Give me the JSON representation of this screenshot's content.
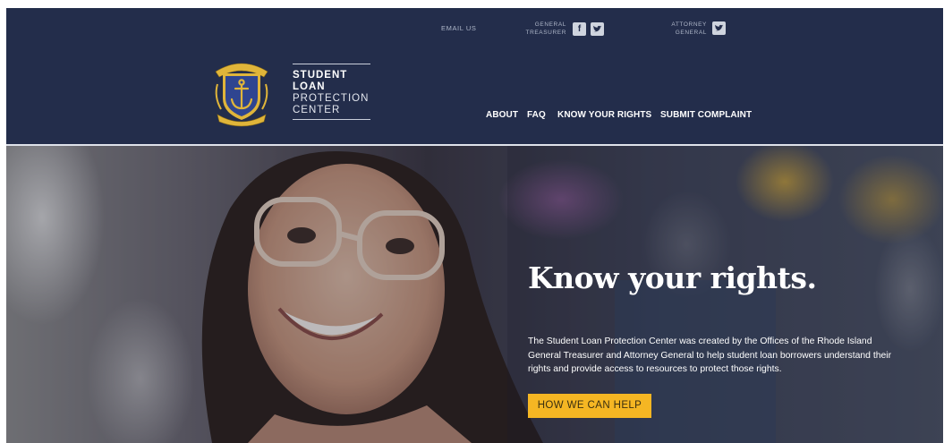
{
  "header": {
    "utility": {
      "email_label": "EMAIL US",
      "treasurer_label_line1": "GENERAL",
      "treasurer_label_line2": "TREASURER",
      "attorney_label_line1": "ATTORNEY",
      "attorney_label_line2": "GENERAL",
      "facebook_glyph": "f",
      "twitter_glyph": "t"
    },
    "brand": {
      "line1": "STUDENT",
      "line2": "LOAN",
      "line3": "PROTECTION",
      "line4": "CENTER"
    },
    "nav": [
      "ABOUT",
      "FAQ",
      "KNOW YOUR RIGHTS",
      "SUBMIT COMPLAINT"
    ]
  },
  "hero": {
    "title": "Know your rights.",
    "body": "The Student Loan Protection Center was created by the Offices of the Rhode Island General Treasurer and Attorney General to help student loan borrowers understand their rights and provide access to resources to protect those rights.",
    "cta_label": "HOW WE CAN HELP"
  },
  "colors": {
    "header_bg": "#232d4b",
    "cta_bg": "#f5b623",
    "seal_gold": "#e0b53a",
    "seal_blue": "#2f4590"
  },
  "icons": {
    "seal": "rhode-island-state-seal",
    "facebook": "facebook-icon",
    "twitter": "twitter-icon"
  }
}
